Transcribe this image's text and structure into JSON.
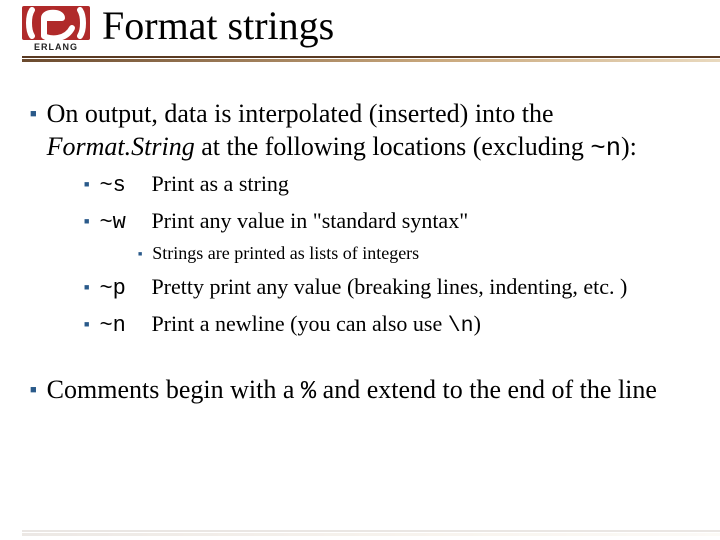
{
  "logo_label": "ERLANG",
  "title": "Format strings",
  "p1_a": "On output, data is interpolated (inserted) into the ",
  "p1_b": "Format.String",
  "p1_c": " at the following locations (excluding ",
  "p1_d": "~n",
  "p1_e": "):",
  "fmt": {
    "s_code": "~s",
    "s_desc": "Print as a string",
    "w_code": "~w",
    "w_desc": "Print any value in \"standard syntax\"",
    "note": "Strings are printed as lists of integers",
    "p_code": "~p",
    "p_desc": "Pretty print any value (breaking lines, indenting, etc. )",
    "n_code": "~n",
    "n_desc_a": "Print a newline (you can also use ",
    "n_desc_b": "\\n",
    "n_desc_c": ")"
  },
  "p2_a": "Comments begin with a ",
  "p2_b": "%",
  "p2_c": " and extend to the end of the line"
}
